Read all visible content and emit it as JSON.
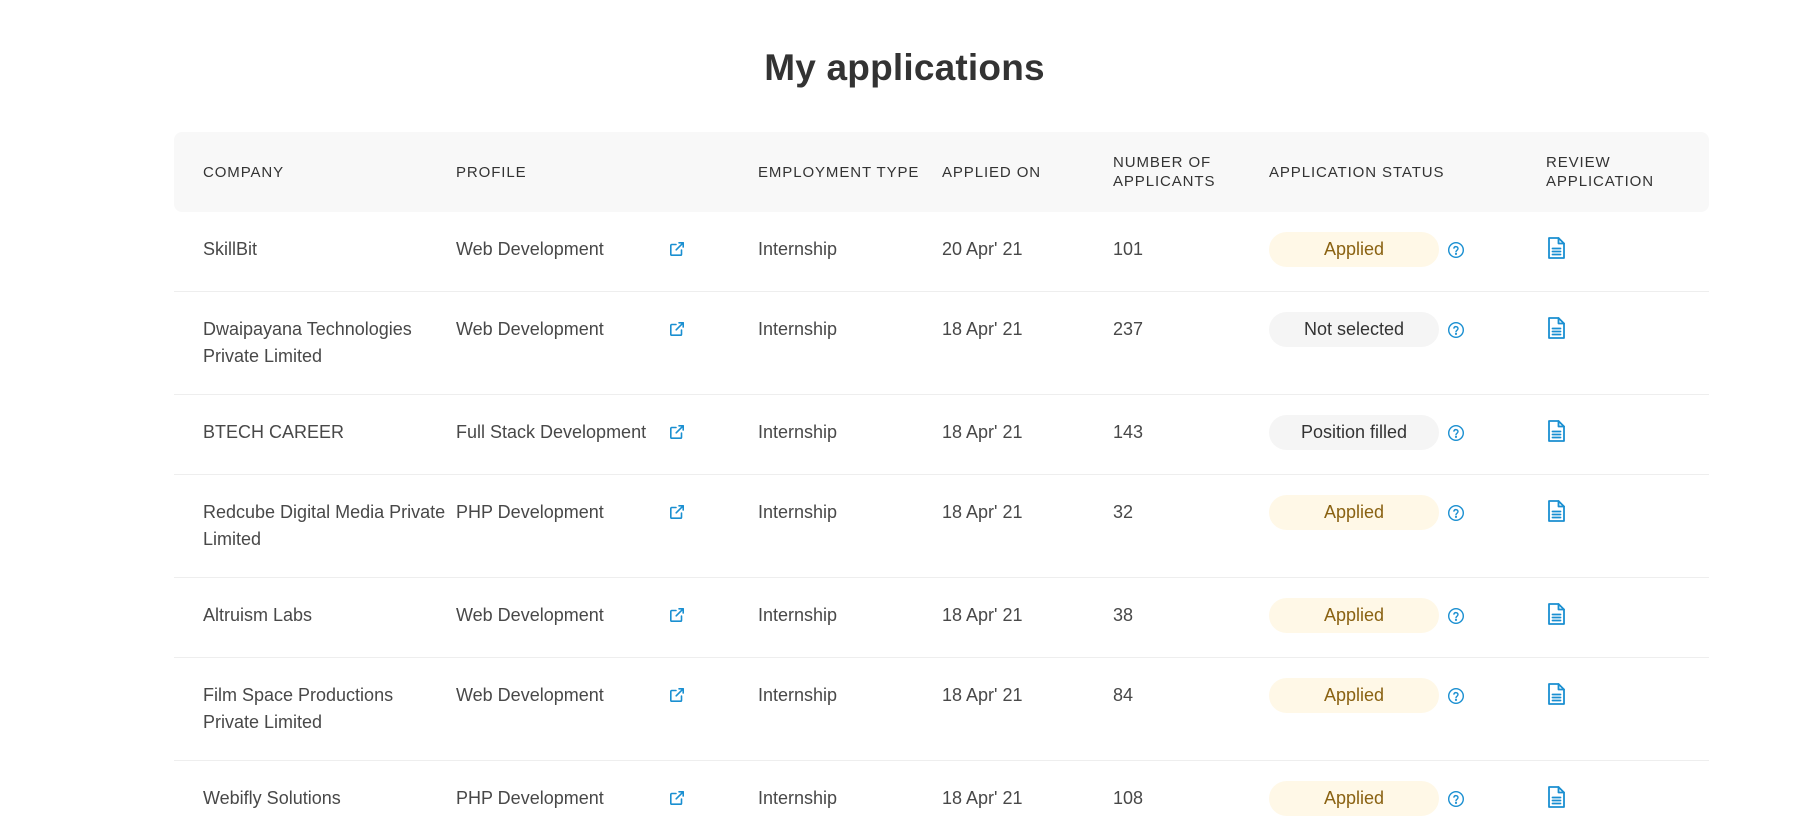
{
  "page": {
    "title": "My applications"
  },
  "table": {
    "headers": {
      "company": "COMPANY",
      "profile": "PROFILE",
      "employment_type": "EMPLOYMENT TYPE",
      "applied_on": "APPLIED ON",
      "applicants": "NUMBER OF APPLICANTS",
      "status": "APPLICATION STATUS",
      "review": "REVIEW APPLICATION"
    },
    "rows": [
      {
        "company": "SkillBit",
        "profile": "Web Development",
        "employment_type": "Internship",
        "applied_on": "20 Apr' 21",
        "applicants": "101",
        "status": "Applied",
        "status_kind": "applied"
      },
      {
        "company": "Dwaipayana Technologies Private Limited",
        "profile": "Web Development",
        "employment_type": "Internship",
        "applied_on": "18 Apr' 21",
        "applicants": "237",
        "status": "Not selected",
        "status_kind": "neutral"
      },
      {
        "company": "BTECH CAREER",
        "profile": "Full Stack Development",
        "employment_type": "Internship",
        "applied_on": "18 Apr' 21",
        "applicants": "143",
        "status": "Position filled",
        "status_kind": "neutral"
      },
      {
        "company": "Redcube Digital Media Private Limited",
        "profile": "PHP Development",
        "employment_type": "Internship",
        "applied_on": "18 Apr' 21",
        "applicants": "32",
        "status": "Applied",
        "status_kind": "applied"
      },
      {
        "company": "Altruism Labs",
        "profile": "Web Development",
        "employment_type": "Internship",
        "applied_on": "18 Apr' 21",
        "applicants": "38",
        "status": "Applied",
        "status_kind": "applied"
      },
      {
        "company": "Film Space Productions Private Limited",
        "profile": "Web Development",
        "employment_type": "Internship",
        "applied_on": "18 Apr' 21",
        "applicants": "84",
        "status": "Applied",
        "status_kind": "applied"
      },
      {
        "company": "Webifly Solutions",
        "profile": "PHP Development",
        "employment_type": "Internship",
        "applied_on": "18 Apr' 21",
        "applicants": "108",
        "status": "Applied",
        "status_kind": "applied"
      }
    ]
  },
  "icons": {
    "profile_link": "external-link-icon",
    "status_help": "help-circle-icon",
    "review": "document-icon"
  },
  "colors": {
    "accent": "#1a8fd1",
    "applied_bg": "#fff8e7",
    "applied_text": "#8a6212",
    "neutral_bg": "#f5f5f5",
    "header_bg": "#f8f8f8"
  }
}
